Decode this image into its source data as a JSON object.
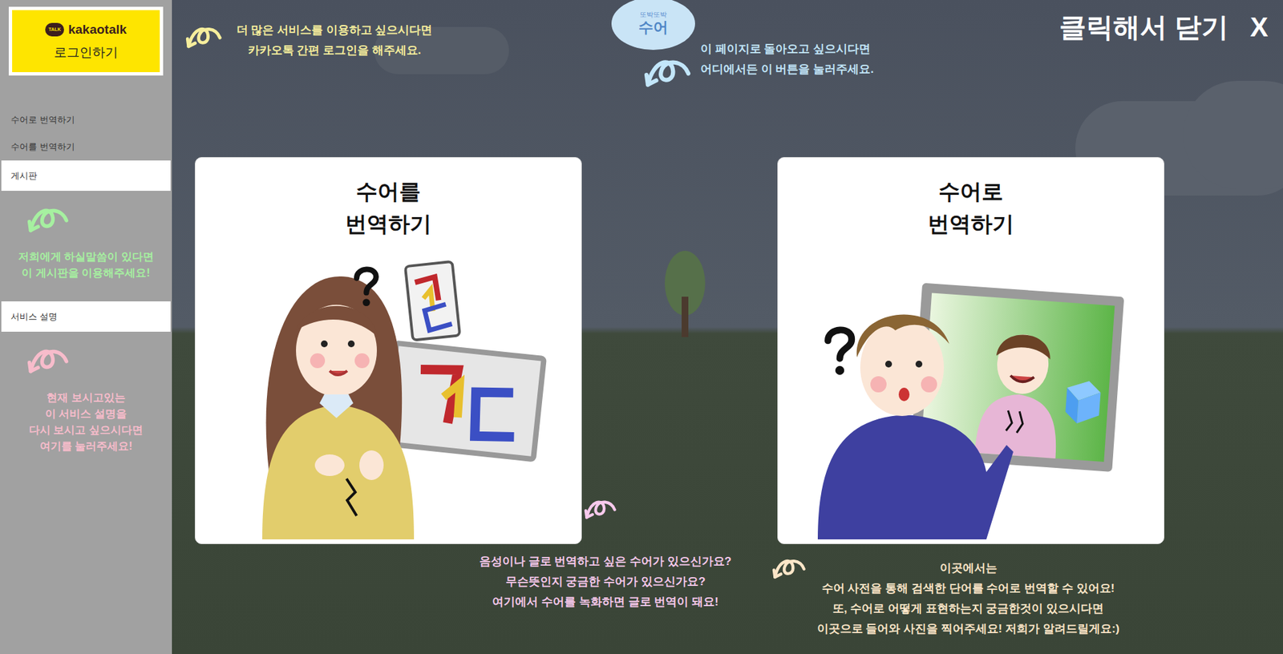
{
  "login_button": {
    "badge": "TALK",
    "brand": "kakaotalk",
    "label": "로그인하기"
  },
  "sidebar": {
    "items": [
      {
        "label": "수어로 번역하기",
        "highlighted": false
      },
      {
        "label": "수어를 번역하기",
        "highlighted": false
      },
      {
        "label": "게시판",
        "highlighted": true,
        "note": {
          "lines": [
            "저희에게 하실말씀이 있다면",
            "이 게시판을 이용해주세요!"
          ],
          "color": "#a6f0a0"
        }
      },
      {
        "label": "서비스 설명",
        "highlighted": true,
        "note": {
          "lines": [
            "현재 보시고있는",
            "이 서비스 설명을",
            "다시 보시고 싶으시다면",
            "여기를 눌러주세요!"
          ],
          "color": "#f7bccb"
        }
      }
    ]
  },
  "logo": {
    "small": "또박또박",
    "main": "수어"
  },
  "close": {
    "label": "클릭해서 닫기",
    "icon": "X"
  },
  "cards": [
    {
      "kind": "sign-to-text",
      "title_lines": [
        "수어를",
        "번역하기"
      ]
    },
    {
      "kind": "text-to-sign",
      "title_lines": [
        "수어로",
        "번역하기"
      ]
    }
  ],
  "tips": [
    {
      "lines": [
        "더 많은 서비스를 이용하고 싶으시다면",
        "카카오톡 간편 로그인을 해주세요."
      ],
      "color": "#f6ee9c"
    },
    {
      "lines": [
        "이 페이지로 돌아오고 싶으시다면",
        "어디에서든 이 버튼을 눌러주세요."
      ],
      "color": "#c2e6fa"
    },
    {
      "lines": [
        "음성이나 글로 번역하고 싶은 수어가 있으신가요?",
        "무슨뜻인지 궁금한 수어가 있으신가요?",
        "여기에서 수어를 녹화하면 글로 번역이 돼요!"
      ],
      "color": "#f7c9ec"
    },
    {
      "lines": [
        "이곳에서는",
        "수어 사전을 통해 검색한 단어를 수어로 번역할 수 있어요!",
        "또, 수어로 어떻게 표현하는지 궁금한것이 있으시다면",
        "이곳으로 들어와 사진을 찍어주세요! 저희가 알려드릴게요:)"
      ],
      "color": "#fde6c8"
    }
  ]
}
